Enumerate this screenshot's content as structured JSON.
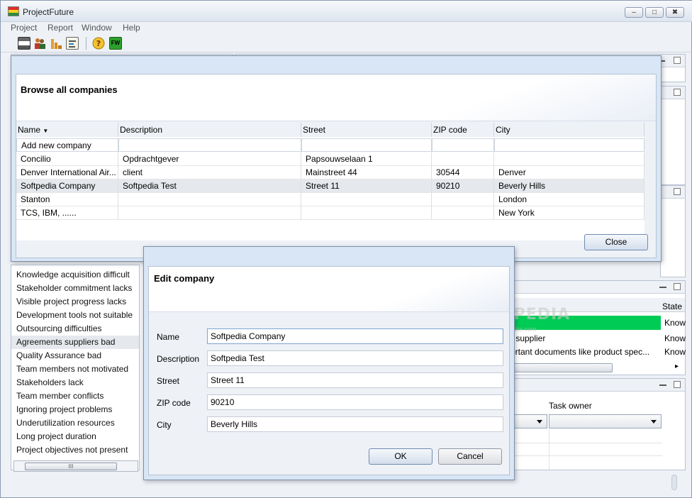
{
  "app": {
    "title": "ProjectFuture"
  },
  "menu": [
    "Project",
    "Report",
    "Window",
    "Help"
  ],
  "toolbar": [
    "save-icon",
    "users-icon",
    "chart-icon",
    "report-icon",
    "help-icon",
    "fw-icon"
  ],
  "toolbar_fw_label": "FW",
  "left_list": [
    "Knowledge acquisition difficult",
    "Stakeholder commitment lacks",
    "Visible project progress lacks",
    "Development tools not suitable",
    "Outsourcing difficulties",
    "Agreements suppliers bad",
    "Quality Assurance bad",
    "Team members not motivated",
    "Stakeholders lack",
    "Team member conflicts",
    "Ignoring project problems",
    "Underutilization resources",
    "Long project duration",
    "Project objectives not present"
  ],
  "left_scroll_grip": "III",
  "right_panel": {
    "state_header": "State",
    "row1": "r supplier",
    "row1_state": "Know",
    "row2": "ortant documents like product spec...",
    "row2_state": "Know",
    "top_state": "Know",
    "task_owner_header": "Task owner"
  },
  "browse_dialog": {
    "title": "Browse all companies",
    "columns": [
      "Name",
      "Description",
      "Street",
      "ZIP code",
      "City"
    ],
    "add_row": "Add new company",
    "rows": [
      [
        "Concilio",
        "Opdrachtgever",
        "Papsouwselaan 1",
        "",
        ""
      ],
      [
        "Denver International Air...",
        "client",
        "Mainstreet 44",
        "30544",
        "Denver"
      ],
      [
        "Softpedia Company",
        "Softpedia Test",
        "Street 11",
        "90210",
        "Beverly Hills"
      ],
      [
        "Stanton",
        "",
        "",
        "",
        "London"
      ],
      [
        "TCS, IBM, ......",
        "",
        "",
        "",
        "New York"
      ]
    ],
    "close_label": "Close"
  },
  "edit_dialog": {
    "title": "Edit company",
    "labels": [
      "Name",
      "Description",
      "Street",
      "ZIP code",
      "City"
    ],
    "values": [
      "Softpedia Company",
      "Softpedia Test",
      "Street 11",
      "90210",
      "Beverly Hills"
    ],
    "ok_label": "OK",
    "cancel_label": "Cancel"
  },
  "watermark": {
    "main": "SOFTPEDIA",
    "sub": "www.softpedia.com"
  },
  "colors": {
    "accent_green": "#00cc55",
    "selection": "#e5e8ec",
    "dialog_frame": "#d8e6f5"
  }
}
